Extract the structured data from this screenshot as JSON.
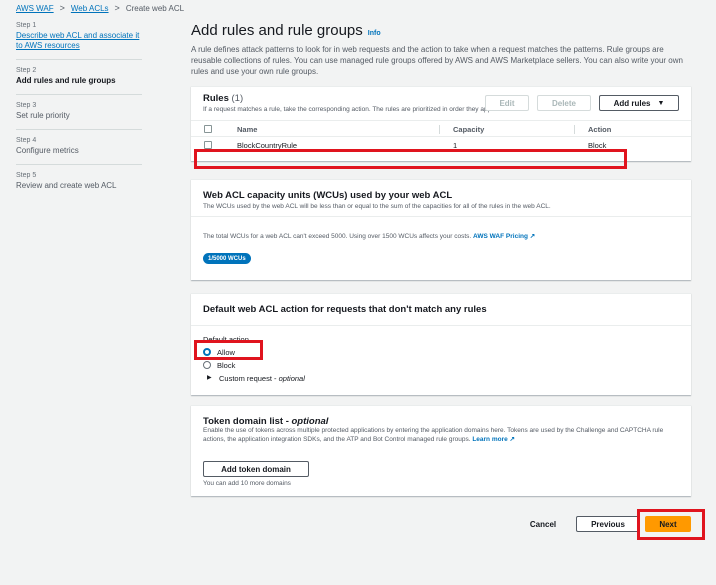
{
  "breadcrumb": {
    "items": [
      "AWS WAF",
      "Web ACLs"
    ],
    "current": "Create web ACL",
    "sep": ">"
  },
  "steps": [
    {
      "num": "Step 1",
      "label": "Describe web ACL and associate it to AWS resources"
    },
    {
      "num": "Step 2",
      "label": "Add rules and rule groups"
    },
    {
      "num": "Step 3",
      "label": "Set rule priority"
    },
    {
      "num": "Step 4",
      "label": "Configure metrics"
    },
    {
      "num": "Step 5",
      "label": "Review and create web ACL"
    }
  ],
  "page": {
    "title": "Add rules and rule groups",
    "info": "Info",
    "description": "A rule defines attack patterns to look for in web requests and the action to take when a request matches the patterns. Rule groups are reusable collections of rules. You can use managed rule groups offered by AWS and AWS Marketplace sellers. You can also write your own rules and use your own rule groups."
  },
  "rules": {
    "title": "Rules",
    "count": "(1)",
    "subtitle": "If a request matches a rule, take the corresponding action. The rules are prioritized in order they appear.",
    "edit": "Edit",
    "delete": "Delete",
    "add": "Add rules",
    "columns": [
      "Name",
      "Capacity",
      "Action"
    ],
    "rows": [
      {
        "name": "BlockCountryRule",
        "capacity": "1",
        "action": "Block"
      }
    ]
  },
  "wcu": {
    "title": "Web ACL capacity units (WCUs) used by your web ACL",
    "subtitle": "The WCUs used by the web ACL will be less than or equal to the sum of the capacities for all of the rules in the web ACL.",
    "note": "The total WCUs for a web ACL can't exceed 5000. Using over 1500 WCUs affects your costs.",
    "pricing_link": "AWS WAF Pricing",
    "badge": "1/5000 WCUs"
  },
  "default_action": {
    "title": "Default web ACL action for requests that don't match any rules",
    "label": "Default action",
    "allow": "Allow",
    "block": "Block",
    "custom_prefix": "Custom request - ",
    "custom_suffix": "optional"
  },
  "token": {
    "title_prefix": "Token domain list - ",
    "title_suffix": "optional",
    "desc": "Enable the use of tokens across multiple protected applications by entering the application domains here. Tokens are used by the Challenge and CAPTCHA rule actions, the application integration SDKs, and the ATP and Bot Control managed rule groups.",
    "learn_more": "Learn more",
    "button": "Add token domain",
    "hint": "You can add 10 more domains"
  },
  "footer": {
    "cancel": "Cancel",
    "previous": "Previous",
    "next": "Next"
  },
  "colors": {
    "accent": "#0073bb",
    "highlight": "#e0141e",
    "primary_button": "#ff9900"
  }
}
